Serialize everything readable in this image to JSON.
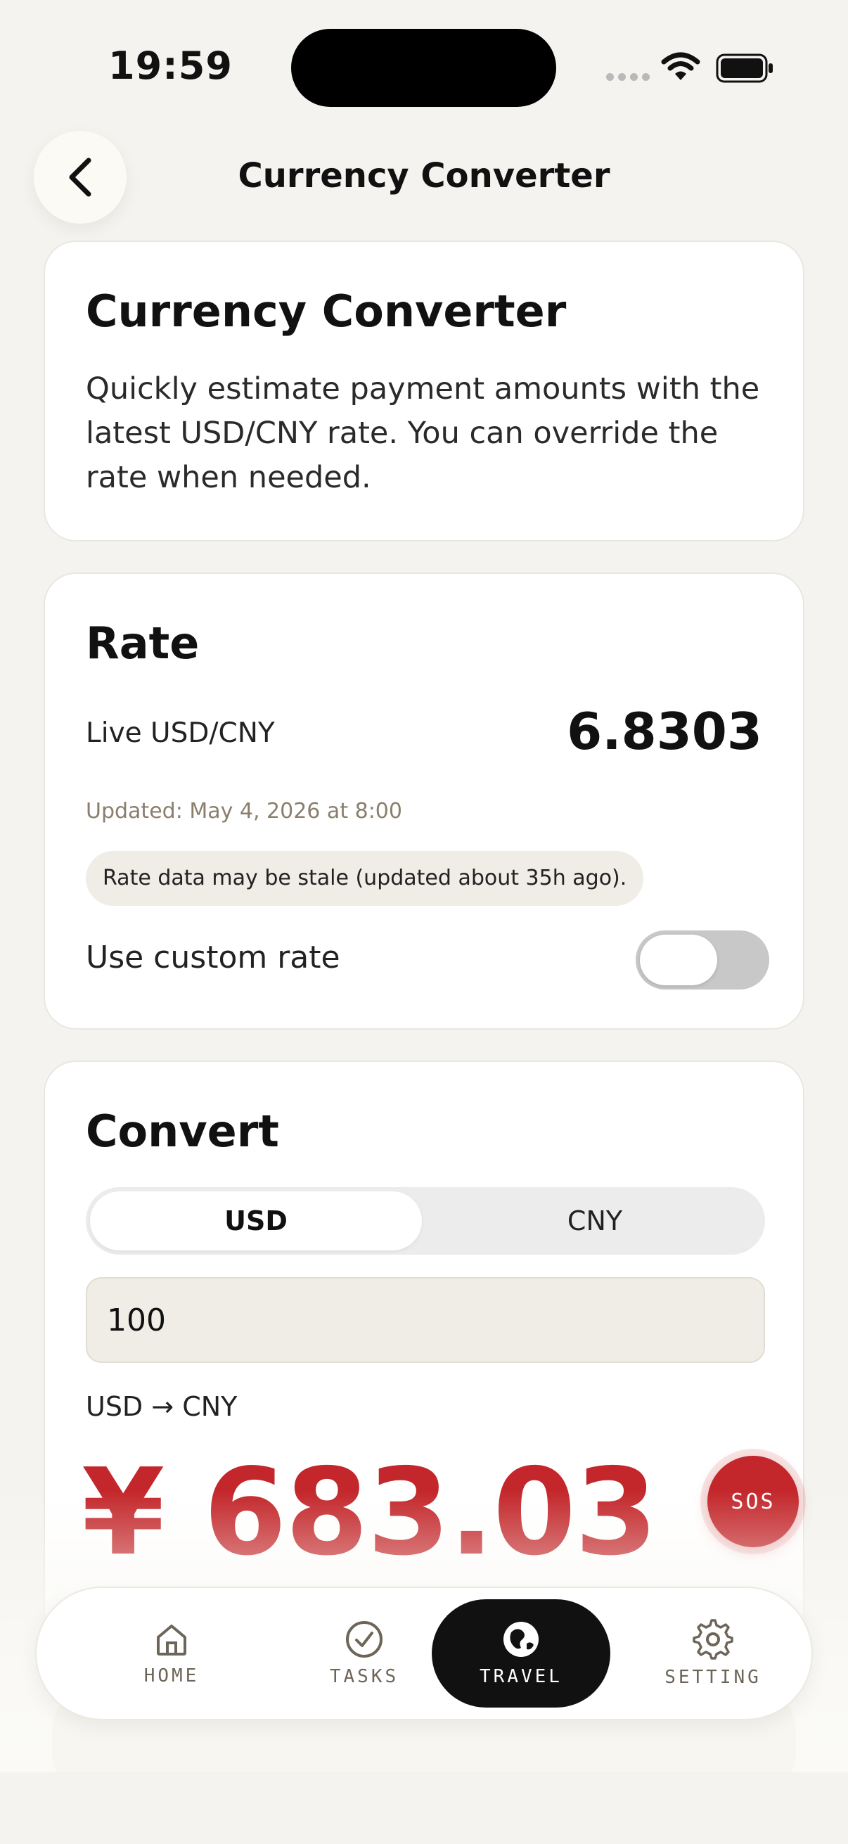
{
  "status_bar": {
    "time": "19:59"
  },
  "header": {
    "title": "Currency Converter"
  },
  "intro": {
    "heading": "Currency Converter",
    "description": "Quickly estimate payment amounts with the latest USD/CNY rate. You can override the rate when needed."
  },
  "rate": {
    "heading": "Rate",
    "live_label": "Live USD/CNY",
    "live_value": "6.8303",
    "updated": "Updated: May 4, 2026 at 8:00",
    "stale_notice": "Rate data may be stale (updated about 35h ago).",
    "custom_label": "Use custom rate",
    "custom_enabled": false
  },
  "convert": {
    "heading": "Convert",
    "options": [
      "USD",
      "CNY"
    ],
    "selected": "USD",
    "amount": "100",
    "direction": "USD → CNY",
    "result": "¥ 683.03"
  },
  "sos": {
    "label": "SOS"
  },
  "tabs": [
    {
      "label": "HOME",
      "icon": "home-icon"
    },
    {
      "label": "TASKS",
      "icon": "check-circle-icon"
    },
    {
      "label": "TRAVEL",
      "icon": "globe-icon",
      "active": true
    },
    {
      "label": "SETTING",
      "icon": "gear-icon"
    }
  ],
  "colors": {
    "accent_red": "#c3272b",
    "background": "#f4f3ef",
    "active_tab": "#111111",
    "muted_text": "#8a7f6d"
  }
}
